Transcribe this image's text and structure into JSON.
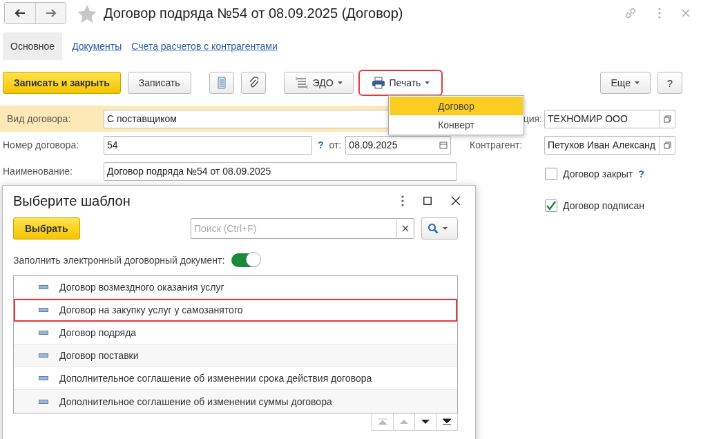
{
  "window": {
    "title": "Договор подряда №54 от 08.09.2025 (Договор)"
  },
  "tabs": [
    {
      "label": "Основное",
      "selected": true
    },
    {
      "label": "Документы",
      "selected": false
    },
    {
      "label": "Счета расчетов с контрагентами",
      "selected": false
    }
  ],
  "toolbar": {
    "save_close": "Записать и закрыть",
    "save": "Записать",
    "edo": "ЭДО",
    "print": {
      "label": "Печать",
      "highlighted": true
    },
    "more": "Еще",
    "help": "?"
  },
  "print_menu": [
    {
      "label": "Договор",
      "selected": true
    },
    {
      "label": "Конверт",
      "selected": false
    }
  ],
  "form": {
    "contract_type": {
      "label": "Вид договора:",
      "value": "С поставщиком"
    },
    "number": {
      "label": "Номер договора:",
      "value": "54",
      "help": "?",
      "date_label": "от:",
      "date": "08.09.2025"
    },
    "name": {
      "label": "Наименование:",
      "value": "Договор подряда №54 от 08.09.2025"
    },
    "organization": {
      "label": "ция:",
      "value": "ТЕХНОМИР ООО"
    },
    "counterparty": {
      "label": "Контрагент:",
      "value": "Петухов Иван Александ"
    },
    "closed": {
      "label": "Договор закрыт",
      "checked": false,
      "help": "?"
    },
    "signed": {
      "label": "Договор подписан",
      "checked": true
    }
  },
  "dialog": {
    "title": "Выберите шаблон",
    "choose_button": "Выбрать",
    "search": {
      "placeholder": "Поиск (Ctrl+F)"
    },
    "fill_toggle": {
      "label": "Заполнить электронный договорный документ:",
      "on": true
    },
    "templates": [
      {
        "label": "Договор возмездного оказания услуг",
        "highlighted": false
      },
      {
        "label": "Договор на закупку услуг у самозанятого",
        "highlighted": true
      },
      {
        "label": "Договор подряда",
        "highlighted": false
      },
      {
        "label": "Договор поставки",
        "highlighted": false
      },
      {
        "label": "Дополнительное соглашение об изменении срока действия договора",
        "highlighted": false
      },
      {
        "label": "Дополнительное соглашение об изменении суммы договора",
        "highlighted": false
      }
    ],
    "pager": [
      {
        "kind": "first",
        "disabled": true
      },
      {
        "kind": "prev",
        "disabled": true
      },
      {
        "kind": "next",
        "disabled": false
      },
      {
        "kind": "last",
        "disabled": false
      }
    ]
  }
}
